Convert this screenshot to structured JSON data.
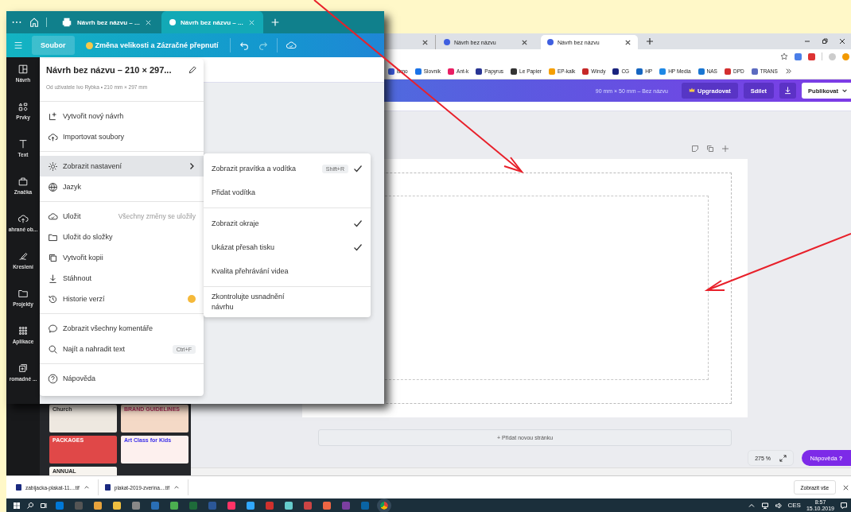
{
  "overlay_window": {
    "browser_tabs": [
      {
        "label": "Návrh bez názvu – ...",
        "selected": false
      },
      {
        "label": "Návrh bez názvu – ...",
        "selected": true
      }
    ],
    "toolbar": {
      "menu_button": "Soubor",
      "resize_button": "Změna velikosti a Zázračné přepnutí"
    },
    "sidebar": [
      {
        "label": "Návrh"
      },
      {
        "label": "Prvky"
      },
      {
        "label": "Text"
      },
      {
        "label": "Značka"
      },
      {
        "label": "ahrané ob..."
      },
      {
        "label": "Kreslení"
      },
      {
        "label": "Projekty"
      },
      {
        "label": "Aplikace"
      },
      {
        "label": "romadné ..."
      }
    ],
    "file_menu": {
      "title": "Návrh bez názvu – 210 × 297...",
      "subtitle": "Od uživatele Ivo Rybka • 210 mm × 297 mm",
      "groups": [
        [
          {
            "label": "Vytvořit nový návrh",
            "selected": false,
            "has_submenu": false,
            "premium": false
          },
          {
            "label": "Importovat soubory",
            "selected": false,
            "has_submenu": false,
            "premium": false
          }
        ],
        [
          {
            "label": "Zobrazit nastavení",
            "selected": true,
            "has_submenu": true,
            "premium": false
          },
          {
            "label": "Jazyk",
            "selected": false,
            "has_submenu": false,
            "premium": false
          }
        ],
        [
          {
            "label": "Uložit",
            "note": "Všechny změny se uložily",
            "selected": false,
            "has_submenu": false,
            "premium": false
          },
          {
            "label": "Uložit do složky",
            "selected": false,
            "has_submenu": false,
            "premium": false
          },
          {
            "label": "Vytvořit kopii",
            "selected": false,
            "has_submenu": false,
            "premium": false
          },
          {
            "label": "Stáhnout",
            "selected": false,
            "has_submenu": false,
            "premium": false
          },
          {
            "label": "Historie verzí",
            "selected": false,
            "has_submenu": false,
            "premium": true
          }
        ],
        [
          {
            "label": "Zobrazit všechny komentáře",
            "selected": false,
            "has_submenu": false,
            "premium": false
          },
          {
            "label": "Najít a nahradit text",
            "shortcut": "Ctrl+F",
            "selected": false,
            "has_submenu": false,
            "premium": false
          }
        ],
        [
          {
            "label": "Nápověda",
            "selected": false,
            "has_submenu": false,
            "premium": false
          }
        ]
      ]
    },
    "settings_submenu": [
      [
        {
          "label": "Zobrazit pravítka a vodítka",
          "shortcut": "Shift+R",
          "checked": true
        },
        {
          "label": "Přidat vodítka",
          "checked": false
        }
      ],
      [
        {
          "label": "Zobrazit okraje",
          "checked": true
        },
        {
          "label": "Ukázat přesah tisku",
          "checked": true
        },
        {
          "label": "Kvalita přehrávání videa",
          "checked": false
        }
      ],
      [
        {
          "label": "Zkontrolujte usnadnění návrhu",
          "checked": false
        }
      ]
    ]
  },
  "background_window": {
    "browser_tabs": [
      {
        "label": "Návrh bez názvu",
        "selected": false
      },
      {
        "label": "Návrh bez názvu",
        "selected": true
      }
    ],
    "bookmarks": [
      "Brno",
      "Slovník",
      "Ant-k",
      "Papyrus",
      "Le Papier",
      "EP-kalk",
      "Windy",
      "CG",
      "HP",
      "HP Media",
      "NAS",
      "DPD",
      "TRANS"
    ],
    "header": {
      "design_size": "90 mm × 50 mm – Bez názvu",
      "upgrade": "Upgradovat",
      "share": "Sdílet",
      "publish": "Publikovat"
    },
    "templates": [
      "Church",
      "BRAND GUIDELINES",
      "PACKAGES",
      "Art Class for Kids",
      "ANNUAL"
    ],
    "add_page": "+ Přidat novou stránku",
    "zoom": "275 %",
    "help": "Nápověda",
    "help_mark": "?",
    "downloads": [
      "zabijacka-plakat-11....tif",
      "plakat-2019-zverina....tif"
    ],
    "show_all": "Zobrazit vše",
    "taskbar": {
      "language": "CES",
      "time": "8:57",
      "date": "15.10.2019"
    }
  }
}
